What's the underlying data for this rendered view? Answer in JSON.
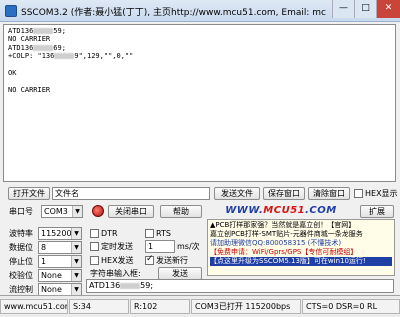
{
  "window": {
    "title": "SSCOM3.2 (作者:聂小猛(丁丁), 主页http://www.mcu51.com,  Email: mc",
    "buttons": {
      "minimize": "—",
      "maximize": "□",
      "close": "✕"
    }
  },
  "receive": {
    "lines": [
      {
        "pre": "ATD136",
        "post": "59;"
      },
      {
        "pre": "NO CARRIER",
        "post": ""
      },
      {
        "pre": "ATD136",
        "post": "69;"
      },
      {
        "pre": "+COLP: \"136",
        "post": "9\",129,\"\",0,\"\""
      },
      {
        "pre": "",
        "post": ""
      },
      {
        "pre": "OK",
        "post": ""
      },
      {
        "pre": "",
        "post": ""
      },
      {
        "pre": "NO CARRIER",
        "post": ""
      }
    ]
  },
  "file_row": {
    "open_file": "打开文件",
    "file_name": "文件名",
    "send_file": "发送文件",
    "save_window": "保存窗口",
    "clear_window": "清除窗口",
    "hex_display": "HEX显示"
  },
  "port_row": {
    "port_label": "串口号",
    "port_value": "COM3",
    "close_port": "关闭串口",
    "help": "帮助",
    "logo_prefix": "WWW.",
    "logo_brand": "MCU51",
    "logo_suffix": ".COM",
    "expand": "扩展"
  },
  "settings": {
    "baud_label": "波特率",
    "baud_value": "115200",
    "data_label": "数据位",
    "data_value": "8",
    "stop_label": "停止位",
    "stop_value": "1",
    "parity_label": "校验位",
    "parity_value": "None",
    "flow_label": "流控制",
    "flow_value": "None"
  },
  "options": {
    "dtr": "DTR",
    "rts": "RTS",
    "timed_send": "定时发送",
    "interval_value": "1",
    "interval_unit": "ms/次",
    "hex_send": "HEX发送",
    "send_newline": "发送新行",
    "char_input": "字符串输入框:",
    "send_button": "发送"
  },
  "send_input": {
    "pre": "ATD136",
    "post": "59;"
  },
  "ad": {
    "lines": [
      "▲PCB打样那家强？当然就是嘉立创！【官网】",
      "嘉立创PCB打样-SMT贴片-元器件商城一条龙服务",
      "请加助理微信QQ:800058315 (不懂技术)",
      "【免费申请：WiFi/Gprs/GPS【专信可耐模组】",
      "【点这里升级为SSCOM5.13版】可在win10运行!"
    ]
  },
  "status": {
    "url": "www.mcu51.cor",
    "sent": "S:34",
    "received": "R:102",
    "port_state": "COM3已打开  115200bps",
    "signals": "CTS=0 DSR=0 RL"
  }
}
